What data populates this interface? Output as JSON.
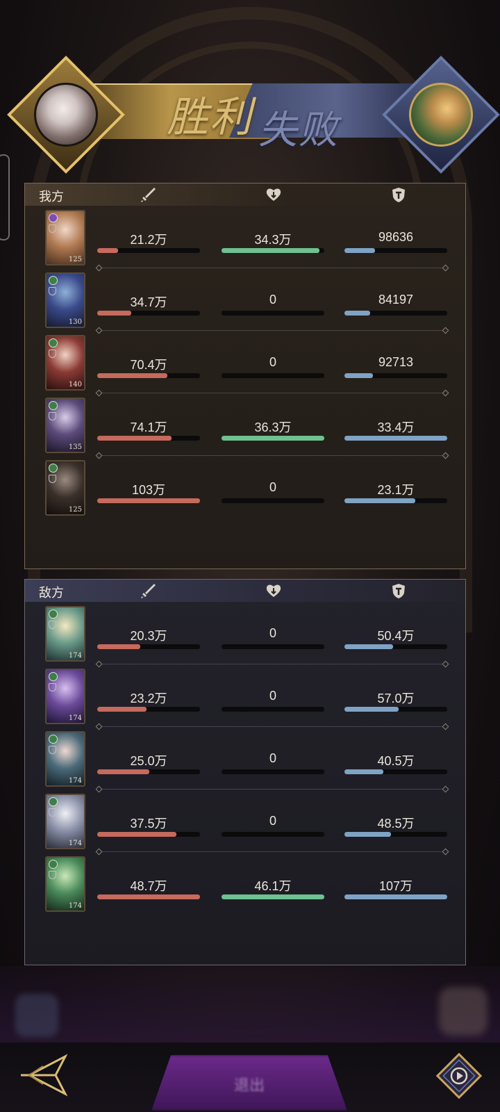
{
  "header": {
    "victory_text": "胜利",
    "defeat_text": "失败"
  },
  "icons": {
    "attack": "sword-icon",
    "heal": "heart-icon",
    "defense": "shield-icon"
  },
  "colors": {
    "attack_bar": "#c56a5c",
    "heal_bar": "#6fc191",
    "defense_bar": "#7fa3c4",
    "gold_accent": "#d9bd76",
    "blue_accent": "#7c86b0"
  },
  "my_team": {
    "title": "我方",
    "heroes": [
      {
        "level": "125",
        "badge": "purple",
        "attack": "21.2万",
        "attack_pct": 0.2,
        "heal": "34.3万",
        "heal_pct": 0.95,
        "defense": "98636",
        "defense_pct": 0.3
      },
      {
        "level": "130",
        "badge": "green",
        "attack": "34.7万",
        "attack_pct": 0.33,
        "heal": "0",
        "heal_pct": 0,
        "defense": "84197",
        "defense_pct": 0.25
      },
      {
        "level": "140",
        "badge": "green",
        "attack": "70.4万",
        "attack_pct": 0.68,
        "heal": "0",
        "heal_pct": 0,
        "defense": "92713",
        "defense_pct": 0.28
      },
      {
        "level": "135",
        "badge": "green",
        "attack": "74.1万",
        "attack_pct": 0.72,
        "heal": "36.3万",
        "heal_pct": 1.0,
        "defense": "33.4万",
        "defense_pct": 1.0
      },
      {
        "level": "125",
        "badge": "green",
        "attack": "103万",
        "attack_pct": 1.0,
        "heal": "0",
        "heal_pct": 0,
        "defense": "23.1万",
        "defense_pct": 0.69
      }
    ]
  },
  "enemy_team": {
    "title": "敌方",
    "heroes": [
      {
        "level": "174",
        "badge": "green",
        "attack": "20.3万",
        "attack_pct": 0.42,
        "heal": "0",
        "heal_pct": 0,
        "defense": "50.4万",
        "defense_pct": 0.47
      },
      {
        "level": "174",
        "badge": "blue",
        "attack": "23.2万",
        "attack_pct": 0.48,
        "heal": "0",
        "heal_pct": 0,
        "defense": "57.0万",
        "defense_pct": 0.53
      },
      {
        "level": "174",
        "badge": "green",
        "attack": "25.0万",
        "attack_pct": 0.51,
        "heal": "0",
        "heal_pct": 0,
        "defense": "40.5万",
        "defense_pct": 0.38
      },
      {
        "level": "174",
        "badge": "green",
        "attack": "37.5万",
        "attack_pct": 0.77,
        "heal": "0",
        "heal_pct": 0,
        "defense": "48.5万",
        "defense_pct": 0.45
      },
      {
        "level": "174",
        "badge": "green",
        "attack": "48.7万",
        "attack_pct": 1.0,
        "heal": "46.1万",
        "heal_pct": 1.0,
        "defense": "107万",
        "defense_pct": 1.0
      }
    ]
  },
  "footer": {
    "center_button_label": "退出",
    "back_icon": "back-arrow-icon",
    "replay_icon": "replay-icon"
  }
}
